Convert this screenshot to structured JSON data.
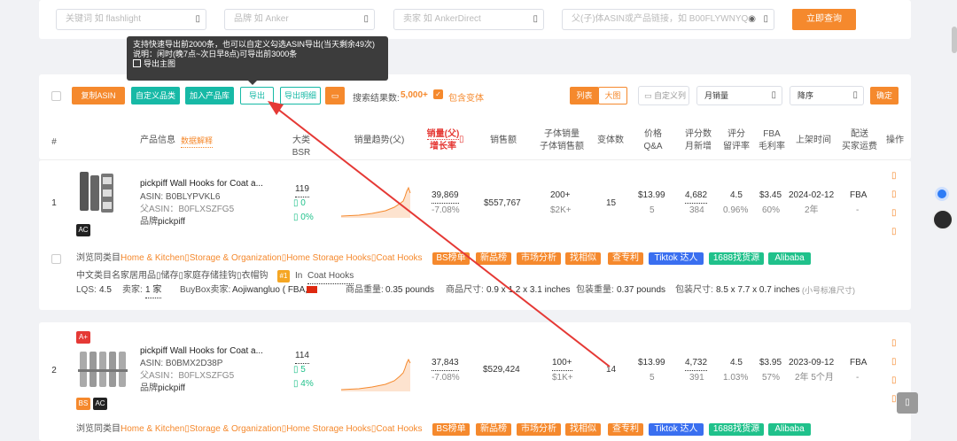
{
  "search": {
    "keyword_placeholder": "关键词 如 flashlight",
    "brand_placeholder": "品牌 如 Anker",
    "seller_placeholder": "卖家 如 AnkerDirect",
    "asin_placeholder": "父(子)体ASIN或产品链接，如 B00FLYWNYQ",
    "query_button": "立即查询",
    "icon_glyph": "▯"
  },
  "tooltip": {
    "line1": "支持快速导出前2000条，也可以自定义勾选ASIN导出(当天剩余49次)",
    "line2": "说明：闲时(晚7点~次日早8点)可导出前3000条",
    "check_label": "导出主图"
  },
  "toolbar": {
    "copy_asin": "复制ASIN",
    "custom_category": "自定义品类",
    "add_library": "加入产品库",
    "export": "导出",
    "export_detail": "导出明细",
    "results_label": "搜索结果数:",
    "results_count": "5,000+",
    "include_variants": "包含变体",
    "view_list": "列表",
    "view_grid": "大图",
    "custom_columns": "自定义列",
    "sort_field": "月销量",
    "sort_order": "降序",
    "confirm": "确定"
  },
  "headers": {
    "num": "#",
    "product_info": "产品信息",
    "data_explain": "数据解释",
    "bsr": "大类BSR",
    "trend": "销量趋势(父)",
    "sales": "销量(父)",
    "growth": "增长率",
    "revenue": "销售额",
    "child_sales": "子体销量",
    "child_revenue": "子体销售额",
    "variants": "变体数",
    "price": "价格",
    "qa": "Q&A",
    "reviews": "评分数",
    "new_month": "月新增",
    "rating": "评分",
    "retention": "留评率",
    "fba": "FBA",
    "margin": "毛利率",
    "launch": "上架时间",
    "delivery": "配送",
    "buyer_ship": "买家运费",
    "action": "操作"
  },
  "rows": [
    {
      "num": "1",
      "title": "pickpiff Wall Hooks for Coat a...",
      "asin": "ASIN: B0BLYPVKL6",
      "parent_asin": "父ASIN：B0FLXSZFG5",
      "brand_label": "品牌:",
      "brand": "pickpiff",
      "badges": [
        "AC"
      ],
      "bsr": "119",
      "bsr_change": "0",
      "bsr_pct": "0%",
      "sales": "39,869",
      "growth": "-7.08%",
      "revenue": "$557,767",
      "child_sales": "200+",
      "child_revenue": "$2K+",
      "variants": "15",
      "price": "$13.99",
      "qa": "5",
      "reviews": "4,682",
      "new_month": "384",
      "rating": "4.5",
      "retention": "0.96%",
      "fba": "$3.45",
      "margin": "60%",
      "launch": "2024-02-12",
      "launch_age": "2年",
      "delivery": "FBA",
      "ship": "-",
      "category_label": "浏览同类目:",
      "category": "Home & Kitchen▯Storage & Organization▯Home Storage Hooks▯Coat Hooks",
      "tags": [
        "BS榜单",
        "新品榜",
        "市场分析",
        "找相似",
        "查专利",
        "Tiktok 达人",
        "1688找货源",
        "Alibaba"
      ],
      "cn_category_label": "中文类目名:",
      "cn_category": "家居用品▯储存▯家庭存储挂钩▯衣帽钩",
      "rank_badge": "#1",
      "rank_in": "In",
      "rank_cat": "Coat Hooks",
      "lqs_label": "LQS:",
      "lqs": "4.5",
      "sellers_label": "卖家:",
      "sellers": "1 家",
      "buybox_label": "BuyBox卖家:",
      "buybox": "Aojiwangluo ( FBA,",
      "item_weight_label": "商品重量:",
      "item_weight": "0.35 pounds",
      "item_size_label": "商品尺寸:",
      "item_size": "0.9 x 1.2 x 3.1 inches",
      "pkg_weight_label": "包装重量:",
      "pkg_weight": "0.37 pounds",
      "pkg_size_label": "包装尺寸:",
      "pkg_size": "8.5 x 7.7 x 0.7 inches",
      "size_class": "(小号标准尺寸)"
    },
    {
      "num": "2",
      "title": "pickpiff Wall Hooks for Coat a...",
      "asin": "ASIN: B0BMX2D38P",
      "parent_asin": "父ASIN：B0FLXSZFG5",
      "brand_label": "品牌:",
      "brand": "pickpiff",
      "badges": [
        "A+",
        "BS",
        "AC"
      ],
      "bsr": "114",
      "bsr_change": "5",
      "bsr_pct": "4%",
      "sales": "37,843",
      "growth": "-7.08%",
      "revenue": "$529,424",
      "child_sales": "100+",
      "child_revenue": "$1K+",
      "variants": "14",
      "price": "$13.99",
      "qa": "5",
      "reviews": "4,732",
      "new_month": "391",
      "rating": "4.5",
      "retention": "1.03%",
      "fba": "$3.95",
      "margin": "57%",
      "launch": "2023-09-12",
      "launch_age": "2年 5个月",
      "delivery": "FBA",
      "ship": "-",
      "category_label": "浏览同类目:",
      "category": "Home & Kitchen▯Storage & Organization▯Home Storage Hooks▯Coat Hooks",
      "tags": [
        "BS榜单",
        "新品榜",
        "市场分析",
        "找相似",
        "查专利",
        "Tiktok 达人",
        "1688找货源",
        "Alibaba"
      ]
    }
  ],
  "colors": {
    "accent": "#f5892d",
    "teal": "#17b9a6",
    "red": "#e53935",
    "green": "#20c18b",
    "blue": "#3a6ff0"
  }
}
